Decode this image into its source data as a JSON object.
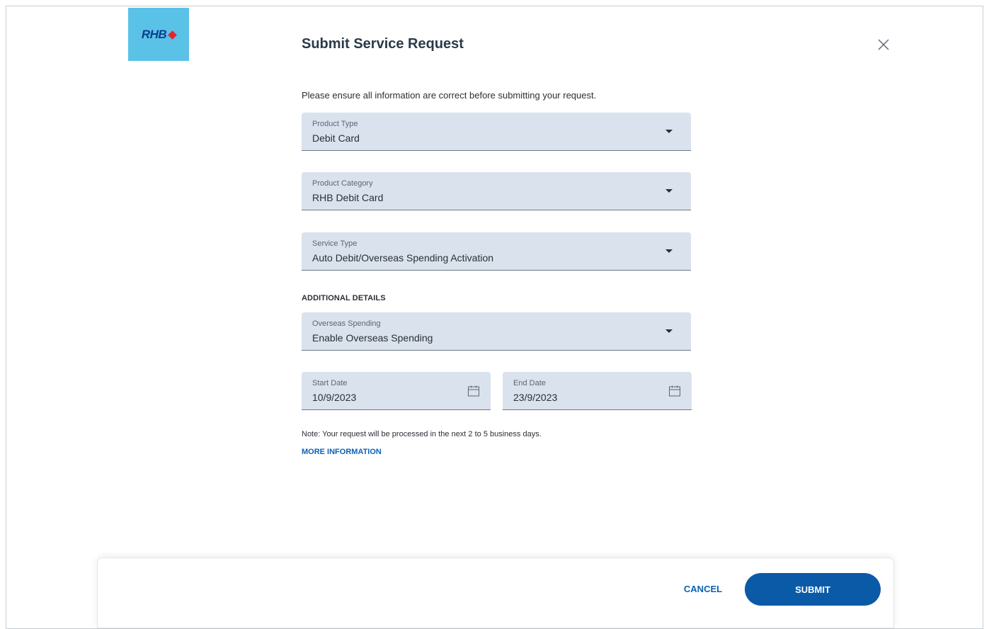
{
  "brand": {
    "logo_text": "RHB",
    "brand_blue": "#5bc2e7",
    "brand_red": "#e3262e"
  },
  "dialog": {
    "title": "Submit Service Request",
    "intro": "Please ensure all information are correct before submitting your request."
  },
  "fields": {
    "product_type": {
      "label": "Product Type",
      "value": "Debit Card",
      "icon": "chevron-down-icon"
    },
    "product_category": {
      "label": "Product Category",
      "value": "RHB Debit Card",
      "icon": "chevron-down-icon"
    },
    "service_type": {
      "label": "Service Type",
      "value": "Auto Debit/Overseas Spending Activation",
      "icon": "chevron-down-icon"
    }
  },
  "additional": {
    "heading": "ADDITIONAL DETAILS",
    "overseas_spending": {
      "label": "Overseas Spending",
      "value": "Enable Overseas Spending",
      "icon": "chevron-down-icon"
    },
    "start_date": {
      "label": "Start Date",
      "value": "10/9/2023",
      "icon": "calendar-icon"
    },
    "end_date": {
      "label": "End Date",
      "value": "23/9/2023",
      "icon": "calendar-icon"
    }
  },
  "note": "Note: Your request will be processed in the next 2 to 5 business days.",
  "more_info": "MORE INFORMATION",
  "footer": {
    "cancel_label": "CANCEL",
    "submit_label": "SUBMIT"
  },
  "colors": {
    "field_bg": "#dae2ed",
    "link": "#0b62b6",
    "primary_button": "#0b5aa8"
  }
}
